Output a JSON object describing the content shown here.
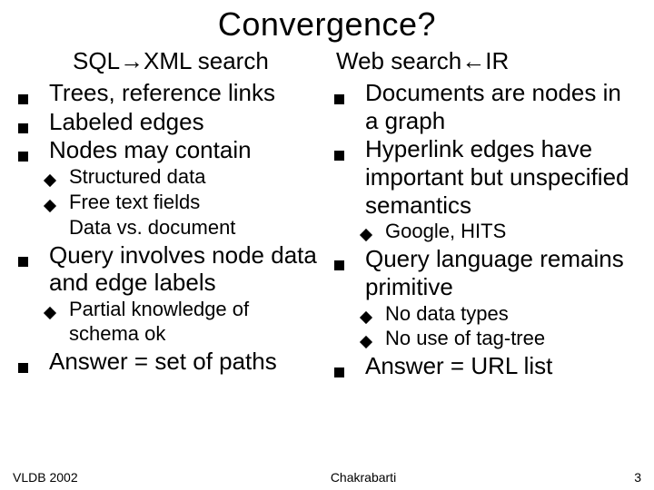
{
  "title": "Convergence?",
  "left": {
    "heading": "SQL→XML search",
    "items": [
      {
        "kind": "l1",
        "text": "Trees, reference links"
      },
      {
        "kind": "l1",
        "text": "Labeled edges"
      },
      {
        "kind": "l1",
        "text": "Nodes may contain"
      },
      {
        "kind": "l2",
        "text": "Structured data"
      },
      {
        "kind": "l2",
        "text": "Free text fields"
      },
      {
        "kind": "l2nb",
        "text": "Data vs. document"
      },
      {
        "kind": "l1",
        "text": "Query involves node data and edge labels"
      },
      {
        "kind": "l2",
        "text": "Partial knowledge of schema ok"
      },
      {
        "kind": "l1",
        "text": "Answer = set of paths"
      }
    ]
  },
  "right": {
    "heading": "Web search←IR",
    "items": [
      {
        "kind": "l1",
        "text": "Documents are nodes in a graph"
      },
      {
        "kind": "l1",
        "text": "Hyperlink edges have important but unspecified semantics"
      },
      {
        "kind": "l2",
        "text": "Google, HITS"
      },
      {
        "kind": "l1",
        "text": "Query language remains primitive"
      },
      {
        "kind": "l2",
        "text": "No data types"
      },
      {
        "kind": "l2",
        "text": "No use of tag-tree"
      },
      {
        "kind": "l1",
        "text": "Answer = URL list"
      }
    ]
  },
  "footer": {
    "left": "VLDB 2002",
    "center": "Chakrabarti",
    "right": "3"
  }
}
